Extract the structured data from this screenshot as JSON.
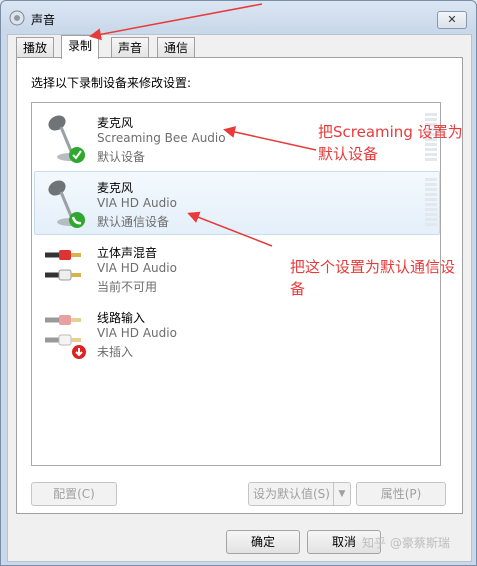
{
  "window": {
    "title": "声音",
    "close_label": "✕"
  },
  "tabs": [
    {
      "label": "播放"
    },
    {
      "label": "录制"
    },
    {
      "label": "声音"
    },
    {
      "label": "通信"
    }
  ],
  "instruction": "选择以下录制设备来修改设置:",
  "devices": [
    {
      "name": "麦克风",
      "driver": "Screaming Bee Audio",
      "status": "默认设备",
      "icon": "microphone-icon",
      "badge": "green-check-icon"
    },
    {
      "name": "麦克风",
      "driver": "VIA HD Audio",
      "status": "默认通信设备",
      "icon": "microphone-icon",
      "badge": "phone-badge-icon"
    },
    {
      "name": "立体声混音",
      "driver": "VIA HD Audio",
      "status": "当前不可用",
      "icon": "rca-cable-icon",
      "badge": ""
    },
    {
      "name": "线路输入",
      "driver": "VIA HD Audio",
      "status": "未插入",
      "icon": "rca-cable-icon",
      "badge": "down-arrow-badge-icon"
    }
  ],
  "buttons": {
    "configure": "配置(C)",
    "set_default": "设为默认值(S)",
    "split_arrow": "▼",
    "properties": "属性(P)",
    "ok": "确定",
    "cancel": "取消"
  },
  "annotations": {
    "first": "把Screaming 设置为默认设备",
    "second": "把这个设置为默认通信设备"
  },
  "watermark": "知乎 @豪蔡斯瑞",
  "colors": {
    "annotation": "#e83a3a",
    "selection": "#e4eff9",
    "check": "#2ea82e"
  }
}
